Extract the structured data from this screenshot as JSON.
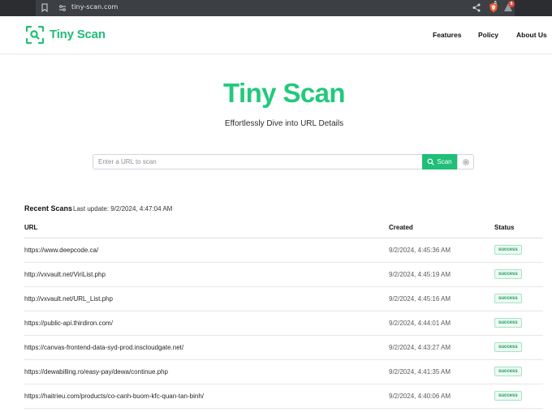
{
  "browser": {
    "url": "tiny-scan.com",
    "brave_badge": "5",
    "alert_badge": "8"
  },
  "header": {
    "logo_text": "Tiny Scan",
    "nav": [
      {
        "label": "Features"
      },
      {
        "label": "Policy"
      },
      {
        "label": "About Us"
      }
    ]
  },
  "hero": {
    "title": "Tiny Scan",
    "subtitle": "Effortlessly Dive into URL Details"
  },
  "search": {
    "placeholder": "Enter a URL to scan",
    "button_label": "Scan"
  },
  "recent": {
    "title": "Recent Scans",
    "last_update": "Last update: 9/2/2024, 4:47:04 AM",
    "columns": {
      "url": "URL",
      "created": "Created",
      "status": "Status"
    },
    "rows": [
      {
        "url": "https://www.deepcode.ca/",
        "created": "9/2/2024, 4:45:36 AM",
        "status": "success"
      },
      {
        "url": "http://vxvault.net/ViriList.php",
        "created": "9/2/2024, 4:45:19 AM",
        "status": "success"
      },
      {
        "url": "http://vxvault.net/URL_List.php",
        "created": "9/2/2024, 4:45:16 AM",
        "status": "success"
      },
      {
        "url": "https://public-api.thirdiron.com/",
        "created": "9/2/2024, 4:44:01 AM",
        "status": "success"
      },
      {
        "url": "https://canvas-frontend-data-syd-prod.inscloudgate.net/",
        "created": "9/2/2024, 4:43:27 AM",
        "status": "success"
      },
      {
        "url": "https://dewabilling.ro/easy-pay/dewa/continue.php",
        "created": "9/2/2024, 4:41:35 AM",
        "status": "success"
      },
      {
        "url": "https://haitrieu.com/products/co-canh-buom-kfc-quan-tan-binh/",
        "created": "9/2/2024, 4:40:06 AM",
        "status": "success"
      }
    ]
  },
  "colors": {
    "brand": "#1fbf77",
    "badge_text": "#1a9d5f",
    "badge_bg": "#edfaf3"
  },
  "icons": {
    "logo": "scan-frame-search-icon",
    "scan_button": "search-icon",
    "settings": "gear-icon"
  }
}
